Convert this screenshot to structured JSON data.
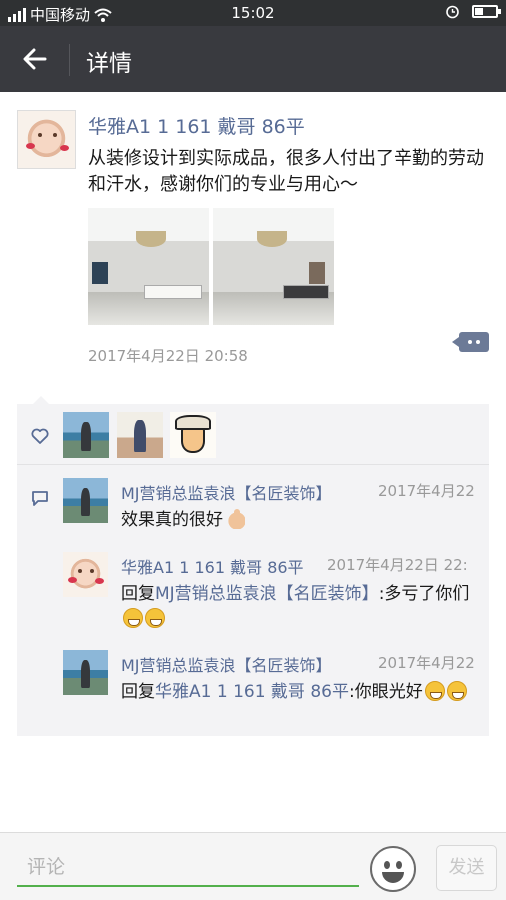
{
  "status_bar": {
    "carrier": "中国移动",
    "time": "15:02"
  },
  "app_bar": {
    "title": "详情"
  },
  "post": {
    "author": "华雅A1 1 161 戴哥 86平",
    "text": "从装修设计到实际成品，很多人付出了辛勤的劳动和汗水，感谢你们的专业与用心～",
    "timestamp": "2017年4月22日 20:58",
    "photos": [
      "living-room-photo-1",
      "living-room-photo-2"
    ]
  },
  "likes": {
    "avatars": [
      "seaside-avatar",
      "girl-avatar",
      "anime-avatar"
    ]
  },
  "comments": [
    {
      "author": "MJ营销总监袁浪【名匠装饰】",
      "time": "2017年4月22",
      "text": "效果真的很好"
    },
    {
      "author": "华雅A1 1 161 戴哥 86平",
      "time": "2017年4月22日 22:",
      "reply_prefix": "回复",
      "reply_to": "MJ营销总监袁浪【名匠装饰】",
      "text": ":多亏了你们"
    },
    {
      "author": "MJ营销总监袁浪【名匠装饰】",
      "time": "2017年4月22",
      "reply_prefix": "回复",
      "reply_to": "华雅A1 1 161 戴哥 86平",
      "text": ":你眼光好"
    }
  ],
  "composer": {
    "placeholder": "评论",
    "send_label": "发送"
  },
  "colors": {
    "appbar": "#393a3f",
    "link": "#576b95",
    "input_underline": "#53b04c"
  }
}
